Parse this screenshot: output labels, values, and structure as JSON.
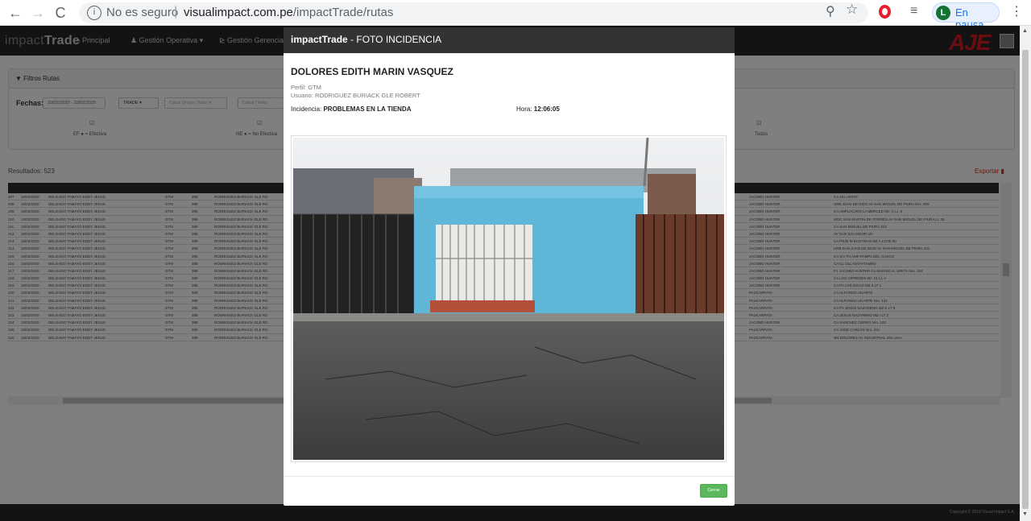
{
  "browser": {
    "back": "←",
    "forward": "→",
    "reload": "C",
    "security": "No es seguro",
    "url_host": "visualimpact.com.pe",
    "url_path": "/impactTrade/rutas",
    "profile_initial": "L",
    "profile_status": "En pausa"
  },
  "app": {
    "brand_prefix": "impact",
    "brand_name": "Trade",
    "nav": [
      "Principal",
      "Gestión Operativa",
      "Gestión Gerencial"
    ],
    "logo": "AJE",
    "filters_title": "Filtros Rutas",
    "dates_label": "Fechas:",
    "date_range": "10/02/2020 - 10/02/2020",
    "trade": "TRADE",
    "canal_grupo": "Canal Grupo (Todo)",
    "canal": "Canal (Todo)",
    "legend_ef": "EF ● = Efectiva",
    "legend_ne": "NE ● = No Efectiva",
    "legend_todos": "Todos",
    "results": "Resultados: 523",
    "export": "Exportar",
    "columns": [
      "#",
      "FECHA",
      "ENCARGADO",
      "PERFIL",
      "COD USUARIO",
      "USUARIO",
      "DISTRITO",
      "DIRECCIÓN"
    ],
    "rows": [
      [
        "207",
        "10/02/2020",
        "DELGADO TAMAYO EDDY JESUS",
        "GTM",
        "398",
        "RODRIGUEZ BURIACK GLE RO",
        "JACOBO HUNTER",
        "CA OLLANTAY"
      ],
      [
        "208",
        "10/02/2020",
        "DELGADO TAMAYO EDDY JESUS",
        "GTM",
        "398",
        "RODRIGUEZ BURIACK GLE RO",
        "JACOBO HUNTER",
        "URB JUAN DE DIOS AV SAN MIGUEL DE PIURA Nro. 206"
      ],
      [
        "209",
        "10/02/2020",
        "DELGADO TAMAYO EDDY JESUS",
        "GTM",
        "398",
        "RODRIGUEZ BURIACK GLE RO",
        "JACOBO HUNTER",
        "CA AMPLIACION LA MERCED Mz. C Lt. 8"
      ],
      [
        "210",
        "10/02/2020",
        "DELGADO TAMAYO EDDY JESUS",
        "GTM",
        "398",
        "RODRIGUEZ BURIACK GLE RO",
        "JACOBO HUNTER",
        "MOC SAN MARTIN DE PORRES AV SAN MIGUEL DE PIURA Lt. 25"
      ],
      [
        "211",
        "10/02/2020",
        "DELGADO TAMAYO EDDY JESUS",
        "GTM",
        "398",
        "RODRIGUEZ BURIACK GLE RO",
        "JACOBO HUNTER",
        "CA SAN MIGUEL DE PIURA 222"
      ],
      [
        "212",
        "10/02/2020",
        "DELGADO TAMAYO EDDY JESUS",
        "GTM",
        "398",
        "RODRIGUEZ BURIACK GLE RO",
        "JACOBO HUNTER",
        "AV SAN SALVADOR s/n"
      ],
      [
        "213",
        "10/02/2020",
        "DELGADO TAMAYO EDDY JESUS",
        "GTM",
        "398",
        "RODRIGUEZ BURIACK GLE RO",
        "JACOBO HUNTER",
        "CA PSJE M BASTIDAS MZ A LOTE 00"
      ],
      [
        "214",
        "10/02/2020",
        "DELGADO TAMAYO EDDY JESUS",
        "GTM",
        "398",
        "RODRIGUEZ BURIACK GLE RO",
        "JACOBO HUNTER",
        "URB SAN JUAN DE DIOS AV SAN MIGUEL DE PIURA 231"
      ],
      [
        "215",
        "10/02/2020",
        "DELGADO TAMAYO EDDY JESUS",
        "GTM",
        "398",
        "RODRIGUEZ BURIACK GLE RO",
        "JACOBO HUNTER",
        "CA S/V PJ AMP PAMPA DEL CUSCO"
      ],
      [
        "216",
        "10/02/2020",
        "DELGADO TAMAYO EDDY JESUS",
        "GTM",
        "398",
        "RODRIGUEZ BURIACK GLE RO",
        "JACOBO HUNTER",
        "CA CL OLLANTAYTAMBO"
      ],
      [
        "217",
        "10/02/2020",
        "DELGADO TAMAYO EDDY JESUS",
        "GTM",
        "398",
        "RODRIGUEZ BURIACK GLE RO",
        "JACOBO HUNTER",
        "PJ JACOBO HUNTER CA MARISCAL URETA Nro. 202"
      ],
      [
        "218",
        "10/02/2020",
        "DELGADO TAMAYO EDDY JESUS",
        "GTM",
        "398",
        "RODRIGUEZ BURIACK GLE RO",
        "JACOBO HUNTER",
        "CA LOS CIPRESES Mz. 51 Lt. A"
      ],
      [
        "219",
        "10/02/2020",
        "DELGADO TAMAYO EDDY JESUS",
        "GTM",
        "398",
        "RODRIGUEZ BURIACK GLE RO",
        "JACOBO HUNTER",
        "CA PJ LOS INCAS MZ 5 LT 1"
      ],
      [
        "220",
        "10/02/2020",
        "DELGADO TAMAYO EDDY JESUS",
        "GTM",
        "398",
        "RODRIGUEZ BURIACK GLE RO",
        "PAUCARPATA",
        "CA ALFONSO UGARTE"
      ],
      [
        "221",
        "10/02/2020",
        "DELGADO TAMAYO EDDY JESUS",
        "GTM",
        "398",
        "RODRIGUEZ BURIACK GLE RO",
        "PAUCARPATA",
        "CA ALFONSO UGARTE Nro. 132"
      ],
      [
        "222",
        "10/02/2020",
        "DELGADO TAMAYO EDDY JESUS",
        "GTM",
        "398",
        "RODRIGUEZ BURIACK GLE RO",
        "PAUCARPATA",
        "CA PJ JESUS NAZARENO MZ K LT 8"
      ],
      [
        "223",
        "10/02/2020",
        "DELGADO TAMAYO EDDY JESUS",
        "GTM",
        "398",
        "RODRIGUEZ BURIACK GLE RO",
        "PAUCARPATA",
        "CA JESUS NAZARENO MZ I LT 2"
      ],
      [
        "224",
        "10/02/2020",
        "DELGADO TAMAYO EDDY JESUS",
        "GTM",
        "398",
        "RODRIGUEZ BURIACK GLE RO",
        "JACOBO HUNTER",
        "CA SANCHEZ CERRO Nro. 102"
      ],
      [
        "225",
        "10/02/2020",
        "DELGADO TAMAYO EDDY JESUS",
        "GTM",
        "398",
        "RODRIGUEZ BURIACK GLE RO",
        "PAUCARPATA",
        "CA JOSE CARLOS Nro. 221"
      ],
      [
        "226",
        "10/02/2020",
        "DELGADO TAMAYO EDDY JESUS",
        "GTM",
        "398",
        "RODRIGUEZ BURIACK GLE RO",
        "PAUCARPATA",
        "NN DOLORES AV INDUSTRIAL 205 cerro"
      ]
    ],
    "footer": "Copyright © 2019 Visual Impact S.A."
  },
  "modal": {
    "title_brand": "impactTrade",
    "title_text": " - FOTO INCIDENCIA",
    "name": "DOLORES EDITH MARIN VASQUEZ",
    "perfil": "Perfil: GTM",
    "usuario": "Usuario: RODRIGUEZ BURIACK GLE ROBERT",
    "incidencia_label": "Incidencia: ",
    "incidencia_value": "PROBLEMAS EN LA TIENDA",
    "hora_label": "Hora: ",
    "hora_value": "12:06:05",
    "close": "Cerrar"
  }
}
